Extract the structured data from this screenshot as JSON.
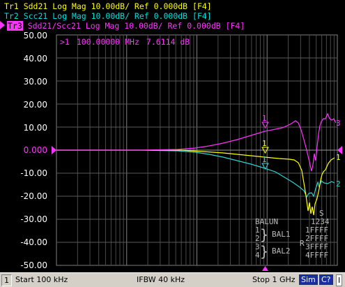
{
  "traces": [
    {
      "id": "hdr-tr1",
      "text": "Tr1 Sdd21 Log Mag 10.00dB/ Ref 0.000dB [F4]",
      "color": "#ffff00"
    },
    {
      "id": "hdr-tr2",
      "text": "Tr2 Scc21 Log Mag 10.00dB/ Ref 0.000dB [F4]",
      "color": "#00e0e0"
    },
    {
      "id": "hdr-tr3",
      "badge": "Tr3",
      "text": "Sdd21/Scc21 Log Mag 10.00dB/ Ref 0.000dB [F4]",
      "color": "#ff33ff"
    }
  ],
  "yaxis": {
    "ticks": [
      "50.00",
      "40.00",
      "30.00",
      "20.00",
      "10.00",
      "0.000",
      "-10.00",
      "-20.00",
      "-30.00",
      "-40.00",
      "-50.00"
    ],
    "ref_label": "0.000"
  },
  "marker": {
    "index": ">1",
    "freq": "100.00000 MHz",
    "value": "7.6114 dB"
  },
  "trace_end_labels": [
    "3",
    "1",
    "2"
  ],
  "marker_flag_labels": [
    "1",
    "1",
    "1"
  ],
  "balun": {
    "title": "BALUN",
    "ports": "1234",
    "rows": [
      "1",
      "2",
      "3",
      "4"
    ],
    "bal1": "BAL1",
    "bal2": "BAL2",
    "flags": [
      "1FFFF",
      "2FFFF",
      "3FFFF",
      "4FFFF"
    ],
    "s_flag": "S",
    "r_flag": "R"
  },
  "status": {
    "channel": "1",
    "start": "Start 100 kHz",
    "ifbw": "IFBW 40 kHz",
    "stop": "Stop 1 GHz",
    "sim": "Sim",
    "cal": "C?",
    "end": "I"
  }
}
